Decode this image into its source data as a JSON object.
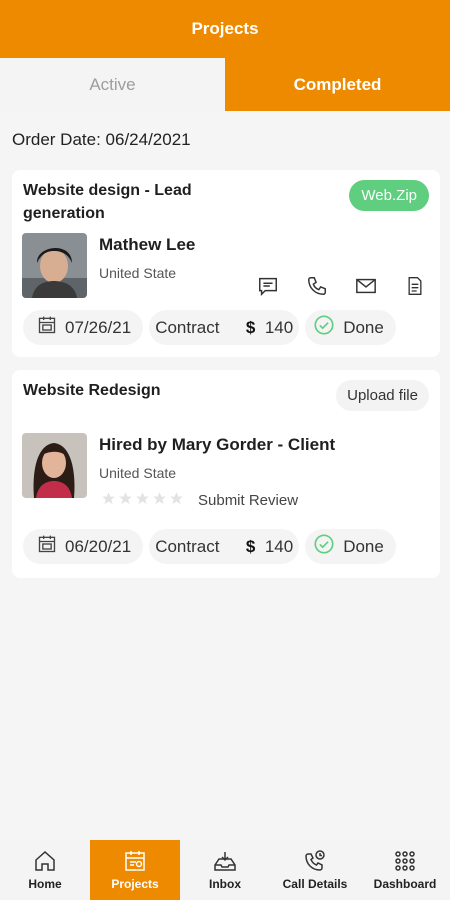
{
  "header": {
    "title": "Projects"
  },
  "tabs": [
    {
      "label": "Active",
      "active": false
    },
    {
      "label": "Completed",
      "active": true
    }
  ],
  "order_date": "Order Date: 06/24/2021",
  "colors": {
    "accent": "#ee8a00",
    "badge_green": "#5fce7e",
    "done_green": "#5fce7e"
  },
  "projects": [
    {
      "title": "Website design - Lead generation",
      "badge": "Web.Zip",
      "person_name": "Mathew Lee",
      "location": "United State",
      "actions": [
        "chat-icon",
        "phone-icon",
        "mail-icon",
        "document-icon"
      ],
      "date": "07/26/21",
      "contract_label": "Contract",
      "currency": "$",
      "amount": "140",
      "status": "Done"
    },
    {
      "title": "Website Redesign",
      "button": "Upload file",
      "person_name": "Hired by Mary Gorder - Client",
      "location": "United State",
      "rating": 0,
      "rating_max": 5,
      "review_link": "Submit Review",
      "date": "06/20/21",
      "contract_label": "Contract",
      "currency": "$",
      "amount": "140",
      "status": "Done"
    }
  ],
  "bottom_nav": [
    {
      "label": "Home",
      "icon": "home-icon",
      "active": false
    },
    {
      "label": "Projects",
      "icon": "projects-icon",
      "active": true
    },
    {
      "label": "Inbox",
      "icon": "inbox-icon",
      "active": false
    },
    {
      "label": "Call Details",
      "icon": "call-details-icon",
      "active": false
    },
    {
      "label": "Dashboard",
      "icon": "dashboard-icon",
      "active": false
    }
  ]
}
